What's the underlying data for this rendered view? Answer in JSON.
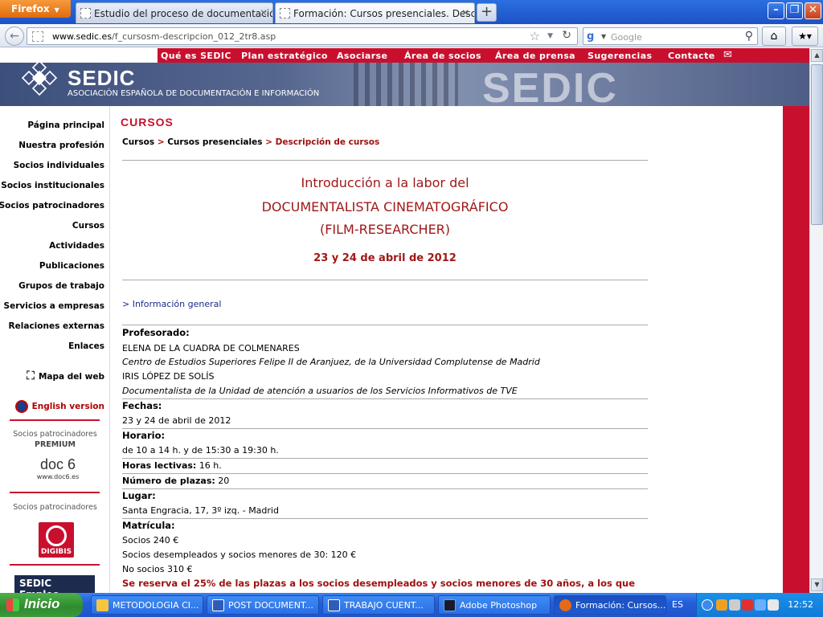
{
  "browser": {
    "menu_button": "Firefox",
    "tabs": [
      {
        "title": "Estudio del proceso de documentación en..."
      },
      {
        "title": "Formación: Cursos presenciales. Descripc..."
      }
    ],
    "url_domain": "www.sedic.es",
    "url_path": "/f_cursosm-descripcion_012_2tr8.asp",
    "search_placeholder": "Google"
  },
  "site": {
    "top_nav": [
      "Qué es SEDIC",
      "Plan estratégico",
      "Asociarse",
      "Área de socios",
      "Área de prensa",
      "Sugerencias",
      "Contacte"
    ],
    "logo_text": "SEDIC",
    "logo_subtitle": "ASOCIACIÓN ESPAÑOLA DE DOCUMENTACIÓN E INFORMACIÓN",
    "banner_watermark": "SEDIC"
  },
  "sidebar": {
    "items": [
      "Página principal",
      "Nuestra profesión",
      "Socios individuales",
      "Socios institucionales",
      "Socios patrocinadores",
      "Cursos",
      "Actividades",
      "Publicaciones",
      "Grupos de trabajo",
      "Servicios a empresas",
      "Relaciones externas",
      "Enlaces"
    ],
    "sitemap": "Mapa del web",
    "english": "English version",
    "premium_caption": "Socios patrocinadores",
    "premium_tag": "PREMIUM",
    "doc6_logo": "doc 6",
    "doc6_url": "www.doc6.es",
    "sponsors_caption": "Socios patrocinadores",
    "digibis": "DIGIBIS",
    "sedic_empleo": "SEDIC Empleo"
  },
  "main": {
    "section": "CURSOS",
    "breadcrumb": [
      "Cursos",
      "Cursos presenciales",
      "Descripción de cursos"
    ],
    "title_line1": "Introducción a la labor del",
    "title_line2": "DOCUMENTALISTA CINEMATOGRÁFICO",
    "title_line3": "(FILM-RESEARCHER)",
    "dates_heading": "23 y 24 de abril de 2012",
    "info_link": "> Información general",
    "profesorado_label": "Profesorado:",
    "prof1_name": "ELENA DE LA CUADRA DE COLMENARES",
    "prof1_org": "Centro de Estudios Superiores Felipe II de Aranjuez, de la Universidad Complutense de Madrid",
    "prof2_name": "IRIS LÓPEZ DE SOLÍS",
    "prof2_org": "Documentalista de la Unidad de atención a usuarios de los Servicios Informativos de TVE",
    "fechas_label": "Fechas:",
    "fechas_value": "23 y 24 de abril de 2012",
    "horario_label": "Horario:",
    "horario_value": "de 10 a 14 h. y de 15:30 a 19:30 h.",
    "horas_label": "Horas lectivas:",
    "horas_value": "16 h.",
    "plazas_label": "Número de plazas:",
    "plazas_value": "20",
    "lugar_label": "Lugar:",
    "lugar_value": "Santa Engracia, 17, 3º izq. - Madrid",
    "matricula_label": "Matrícula:",
    "matricula_socios": "Socios 240 €",
    "matricula_desempleados": "Socios desempleados y socios menores de 30: 120 €",
    "matricula_no_socios": "No socios 310 €",
    "reserve_note": "Se reserva el 25% de las plazas a los socios desempleados y socios menores de 30 años, a los que"
  },
  "taskbar": {
    "start": "Inicio",
    "tasks": [
      "METODOLOGIA CI...",
      "POST DOCUMENT...",
      "TRABAJO CUENT...",
      "Adobe Photoshop",
      "Formación: Cursos..."
    ],
    "lang": "ES",
    "clock": "12:52"
  },
  "colors": {
    "brand_red": "#c8102e",
    "title_red": "#a01818",
    "link_blue": "#1a2c8a"
  }
}
